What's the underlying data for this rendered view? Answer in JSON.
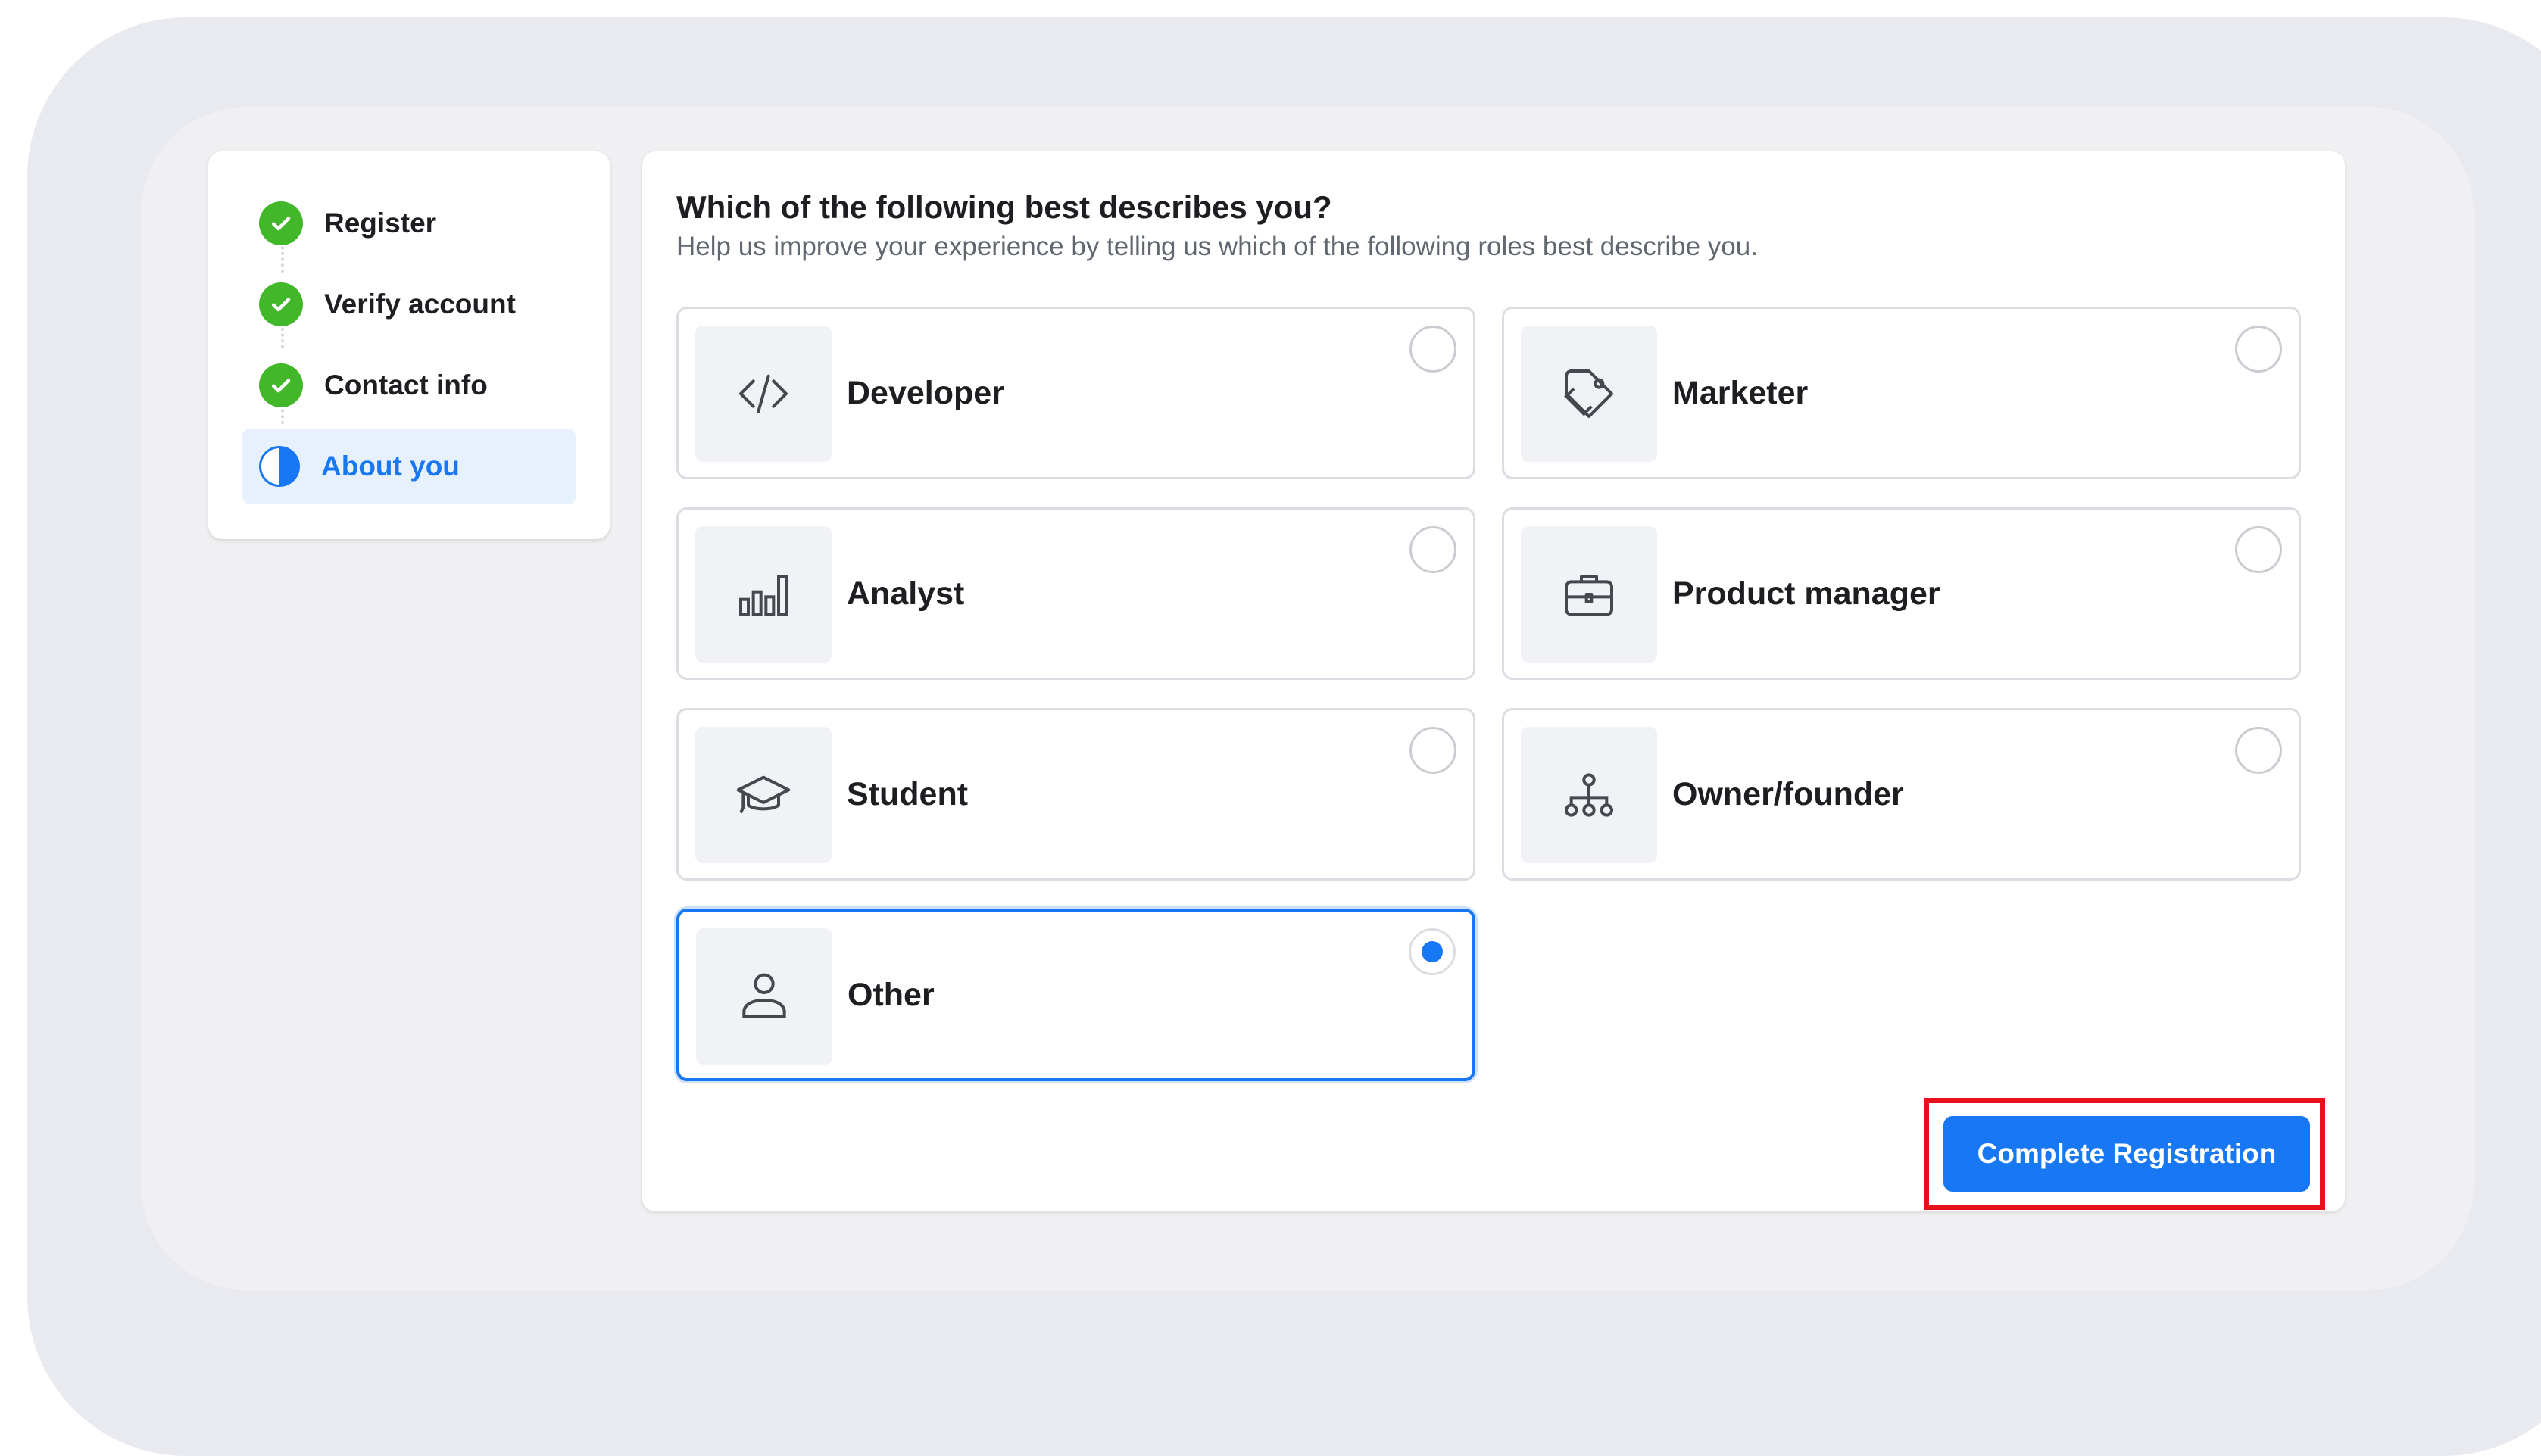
{
  "stepper": {
    "steps": [
      {
        "label": "Register",
        "status": "complete"
      },
      {
        "label": "Verify account",
        "status": "complete"
      },
      {
        "label": "Contact info",
        "status": "complete"
      },
      {
        "label": "About you",
        "status": "current"
      }
    ]
  },
  "main": {
    "title": "Which of the following best describes you?",
    "subtitle": "Help us improve your experience by telling us which of the following roles best describe you.",
    "options": [
      {
        "label": "Developer",
        "icon": "code-icon",
        "selected": false
      },
      {
        "label": "Marketer",
        "icon": "tag-icon",
        "selected": false
      },
      {
        "label": "Analyst",
        "icon": "bar-chart-icon",
        "selected": false
      },
      {
        "label": "Product manager",
        "icon": "briefcase-icon",
        "selected": false
      },
      {
        "label": "Student",
        "icon": "graduation-cap-icon",
        "selected": false
      },
      {
        "label": "Owner/founder",
        "icon": "org-chart-icon",
        "selected": false
      },
      {
        "label": "Other",
        "icon": "person-icon",
        "selected": true
      }
    ],
    "submit_label": "Complete Registration"
  },
  "colors": {
    "accent": "#1877f2",
    "success": "#42b72a",
    "highlight": "#e8101c"
  }
}
